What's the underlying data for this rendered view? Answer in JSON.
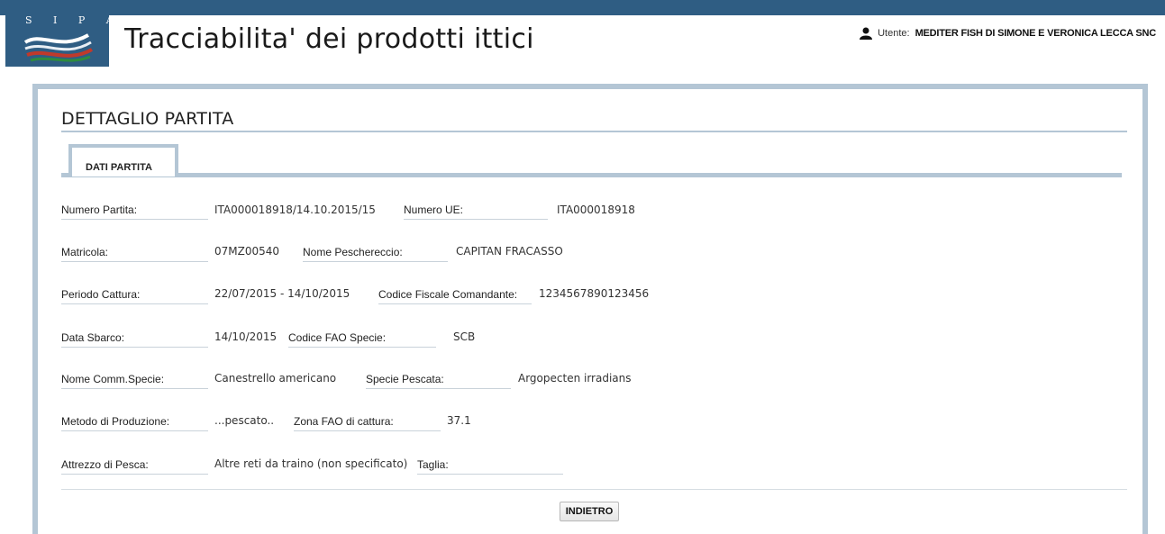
{
  "header": {
    "logo_text": "S I P A",
    "title": "Tracciabilita' dei prodotti ittici",
    "user_label": "Utente:",
    "user_name": "MEDITER FISH DI SIMONE E VERONICA LECCA SNC"
  },
  "page": {
    "section_title": "DETTAGLIO PARTITA",
    "tab_label": "DATI PARTITA"
  },
  "fields": {
    "numero_partita": {
      "label": "Numero Partita:",
      "value": "ITA000018918/14.10.2015/15"
    },
    "numero_ue": {
      "label": "Numero UE:",
      "value": "ITA000018918"
    },
    "matricola": {
      "label": "Matricola:",
      "value": "07MZ00540"
    },
    "nome_peschereccio": {
      "label": "Nome Peschereccio:",
      "value": "CAPITAN FRACASSO"
    },
    "periodo_cattura": {
      "label": "Periodo Cattura:",
      "value": "22/07/2015 - 14/10/2015"
    },
    "codice_fiscale": {
      "label": "Codice Fiscale Comandante:",
      "value": "1234567890123456"
    },
    "data_sbarco": {
      "label": "Data Sbarco:",
      "value": "14/10/2015"
    },
    "codice_fao": {
      "label": "Codice FAO Specie:",
      "value": "SCB"
    },
    "nome_comm": {
      "label": "Nome Comm.Specie:",
      "value": "Canestrello americano"
    },
    "specie_pescata": {
      "label": "Specie Pescata:",
      "value": "Argopecten irradians"
    },
    "metodo_produzione": {
      "label": "Metodo di Produzione:",
      "value": "...pescato.."
    },
    "zona_fao": {
      "label": "Zona FAO di cattura:",
      "value": "37.1"
    },
    "attrezzo_pesca": {
      "label": "Attrezzo di Pesca:",
      "value": "Altre reti da traino (non specificato)"
    },
    "taglia": {
      "label": "Taglia:",
      "value": ""
    }
  },
  "actions": {
    "back_label": "INDIETRO"
  },
  "icons": {
    "user": "user-icon",
    "logo": "sipa-logo"
  },
  "colors": {
    "brand": "#2f5d83",
    "panel_border": "#b4c6d5"
  }
}
